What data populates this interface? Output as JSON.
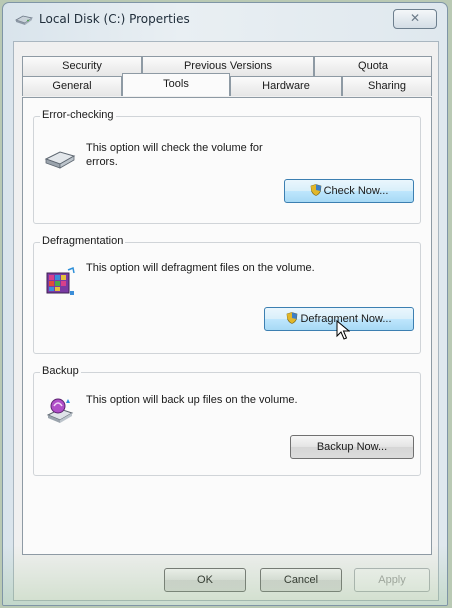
{
  "window": {
    "title": "Local Disk (C:) Properties",
    "close_label": "✕"
  },
  "tabs": {
    "row1": [
      "Security",
      "Previous Versions",
      "Quota"
    ],
    "row2": [
      "General",
      "Tools",
      "Hardware",
      "Sharing"
    ],
    "active": "Tools"
  },
  "error_checking": {
    "title": "Error-checking",
    "description": "This option will check the volume for errors.",
    "button": "Check Now..."
  },
  "defragmentation": {
    "title": "Defragmentation",
    "description": "This option will defragment files on the volume.",
    "button": "Defragment Now..."
  },
  "backup": {
    "title": "Backup",
    "description": "This option will back up files on the volume.",
    "button": "Backup Now..."
  },
  "footer": {
    "ok": "OK",
    "cancel": "Cancel",
    "apply": "Apply"
  },
  "colors": {
    "accent": "#3c7fb1",
    "panel": "#fbfbfb",
    "frame": "#dfe8ee"
  },
  "icons": [
    "drive-icon",
    "shield-icon",
    "defrag-icon",
    "backup-icon",
    "mouse-cursor"
  ]
}
